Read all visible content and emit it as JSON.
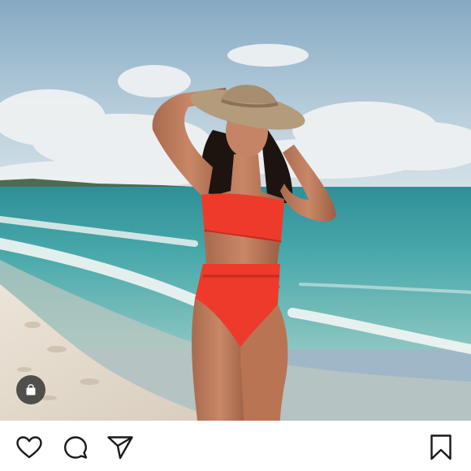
{
  "post": {
    "photo": {
      "subject": "woman-in-red-bikini-and-straw-hat-on-beach",
      "colors": {
        "sky_top": "#87acc4",
        "sky_bottom": "#cfdde6",
        "sea": "#3fa3a8",
        "sand": "#e6ddd0",
        "swimsuit": "#ee3a2a",
        "hat": "#b39a7b"
      }
    },
    "shop_badge": {
      "icon": "shopping-bag-icon",
      "color": "#2b2b2b"
    },
    "actions": {
      "like_icon": "heart-outline-icon",
      "comment_icon": "speech-bubble-icon",
      "share_icon": "paper-plane-icon",
      "save_icon": "bookmark-icon"
    }
  }
}
